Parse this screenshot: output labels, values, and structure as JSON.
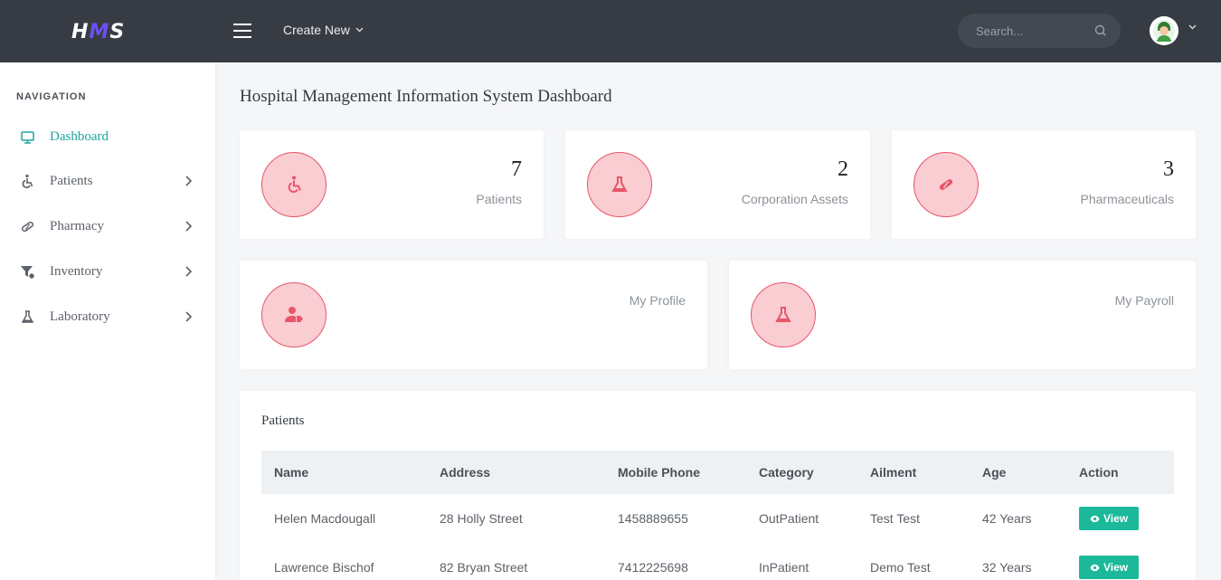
{
  "brand": {
    "logo_part1": "H",
    "logo_part2": "M",
    "logo_part3": "S"
  },
  "topbar": {
    "create_new_label": "Create New",
    "search_placeholder": "Search...",
    "icons": {
      "menu": "hamburger-icon",
      "search": "search-icon",
      "dropdown": "chevron-down-icon"
    }
  },
  "sidebar": {
    "title": "NAVIGATION",
    "items": [
      {
        "label": "Dashboard",
        "icon": "monitor-icon",
        "active": true,
        "has_children": false
      },
      {
        "label": "Patients",
        "icon": "wheelchair-icon",
        "active": false,
        "has_children": true
      },
      {
        "label": "Pharmacy",
        "icon": "pill-icon",
        "active": false,
        "has_children": true
      },
      {
        "label": "Inventory",
        "icon": "funnel-icon",
        "active": false,
        "has_children": true
      },
      {
        "label": "Laboratory",
        "icon": "flask-icon",
        "active": false,
        "has_children": true
      }
    ]
  },
  "main": {
    "title": "Hospital Management Information System Dashboard",
    "stats": [
      {
        "value": "7",
        "label": "Patients",
        "icon": "wheelchair-icon"
      },
      {
        "value": "2",
        "label": "Corporation Assets",
        "icon": "flask-icon"
      },
      {
        "value": "3",
        "label": "Pharmaceuticals",
        "icon": "pill-icon"
      }
    ],
    "shortcuts": [
      {
        "label": "My Profile",
        "icon": "user-tag-icon"
      },
      {
        "label": "My Payroll",
        "icon": "flask-icon"
      }
    ],
    "patients_table": {
      "title": "Patients",
      "columns": [
        "Name",
        "Address",
        "Mobile Phone",
        "Category",
        "Ailment",
        "Age",
        "Action"
      ],
      "rows": [
        {
          "name": "Helen Macdougall",
          "address": "28 Holly Street",
          "phone": "1458889655",
          "category": "OutPatient",
          "ailment": "Test Test",
          "age": "42 Years",
          "action": "View"
        },
        {
          "name": "Lawrence Bischof",
          "address": "82 Bryan Street",
          "phone": "7412225698",
          "category": "InPatient",
          "ailment": "Demo Test",
          "age": "32 Years",
          "action": "View"
        }
      ]
    }
  },
  "colors": {
    "topbar": "#373c44",
    "accent": "#1fa5a0",
    "icon_circle_fill": "#f9cdd2",
    "icon_circle_stroke": "#e8566a",
    "view_button": "#1bb99a"
  }
}
